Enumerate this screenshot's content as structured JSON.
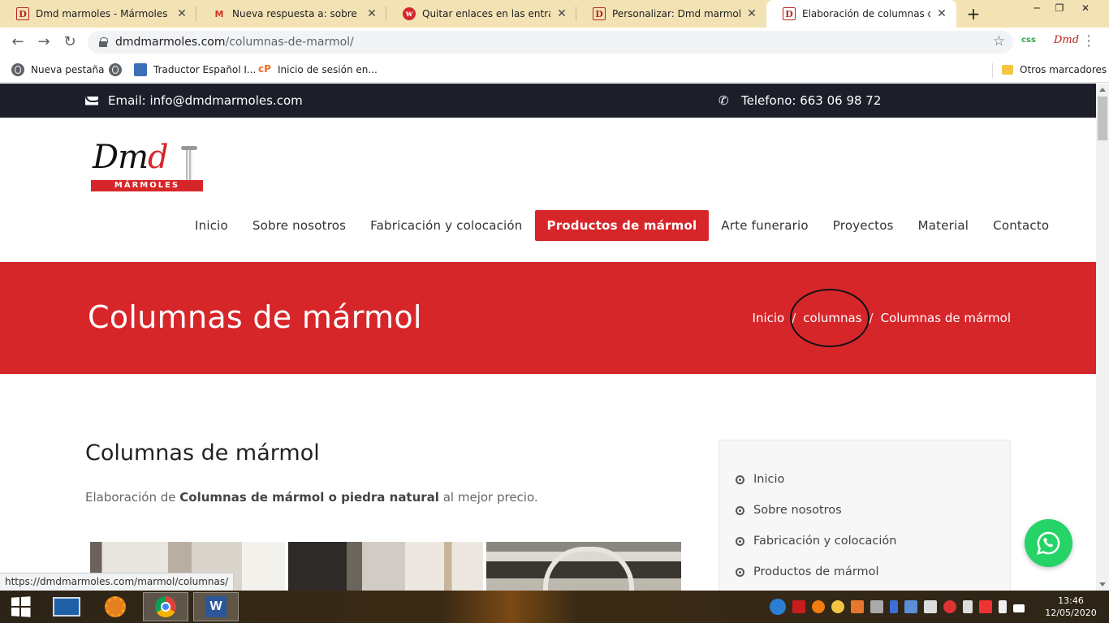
{
  "browser": {
    "tabs": [
      {
        "title": "Dmd marmoles - Mármoles bien",
        "favicon": "dmd-icon"
      },
      {
        "title": "Nueva respuesta a: sobre el colo",
        "favicon": "gmail-icon"
      },
      {
        "title": "Quitar enlaces en las entradas –",
        "favicon": "wordpress-icon"
      },
      {
        "title": "Personalizar: Dmd marmoles - M",
        "favicon": "dmd-icon"
      },
      {
        "title": "Elaboración de columnas de má",
        "favicon": "dmd-icon",
        "active": true
      }
    ],
    "url_domain": "dmdmarmoles.com",
    "url_path": "/columnas-de-marmol/",
    "extensions": [
      "css",
      "Dmd"
    ],
    "bookmarks": [
      {
        "label": "Nueva pestaña",
        "icon": "globe-icon"
      },
      {
        "label": "",
        "icon": "globe-icon"
      },
      {
        "label": "Traductor Español I...",
        "icon": "translator-icon"
      },
      {
        "label": "Inicio de sesión en...",
        "icon": "cp-icon"
      }
    ],
    "other_bookmarks": "Otros marcadores",
    "status_url": "https://dmdmarmoles.com/marmol/columnas/"
  },
  "site": {
    "topbar": {
      "email": "Email: info@dmdmarmoles.com",
      "phone": "Telefono: 663 06 98 72"
    },
    "logo": {
      "script": "Dmd",
      "sub": "MÁRMOLES"
    },
    "nav": [
      {
        "label": "Inicio"
      },
      {
        "label": "Sobre nosotros"
      },
      {
        "label": "Fabricación y colocación"
      },
      {
        "label": "Productos de mármol",
        "active": true
      },
      {
        "label": "Arte funerario"
      },
      {
        "label": "Proyectos"
      },
      {
        "label": "Material"
      },
      {
        "label": "Contacto"
      }
    ],
    "banner": {
      "title": "Columnas de mármol",
      "breadcrumb": [
        "Inicio",
        "columnas",
        "Columnas de mármol"
      ],
      "separator": "/"
    },
    "content": {
      "heading": "Columnas de mármol",
      "lead_pre": "Elaboración de ",
      "lead_bold": "Columnas de mármol o piedra natural",
      "lead_post": " al mejor precio."
    },
    "sidebar": [
      "Inicio",
      "Sobre nosotros",
      "Fabricación y colocación",
      "Productos de mármol"
    ]
  },
  "taskbar": {
    "apps": [
      "start-icon",
      "lenovo-icon",
      "settings-icon",
      "chrome-icon",
      "word-icon"
    ],
    "time": "13:46",
    "date": "12/05/2020"
  },
  "colors": {
    "brand_red": "#d7262a",
    "topbar_dark": "#1c1e2a",
    "whatsapp_green": "#25d366",
    "tabstrip": "#f3e3b4"
  }
}
